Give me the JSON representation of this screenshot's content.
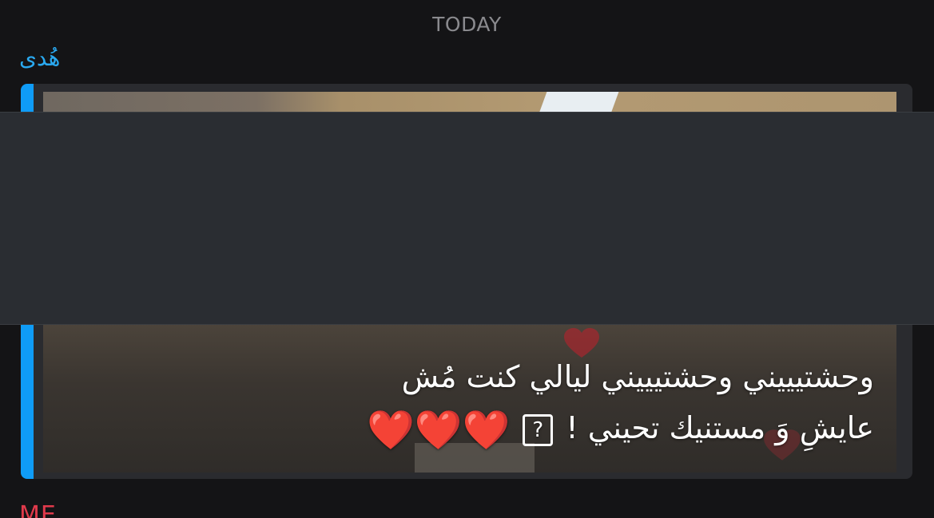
{
  "chat": {
    "date_divider": "TODAY",
    "message": {
      "sender": "هُدى",
      "caption_line1": "وحشتيييني وحشتيييني ليالي كنت مُش",
      "caption_line2": "عايشِ وَ مستنيك تحيني !",
      "unknown_glyph": "?",
      "hearts": [
        "❤️",
        "❤️",
        "❤️"
      ]
    },
    "next_sender": "ME"
  },
  "colors": {
    "background": "#141416",
    "sender_accent": "#2aa9f0",
    "quote_bar": "#0f9cf7",
    "redaction": "#2a2d32",
    "me_accent": "#e03a4b",
    "heart": "#e0242e"
  }
}
